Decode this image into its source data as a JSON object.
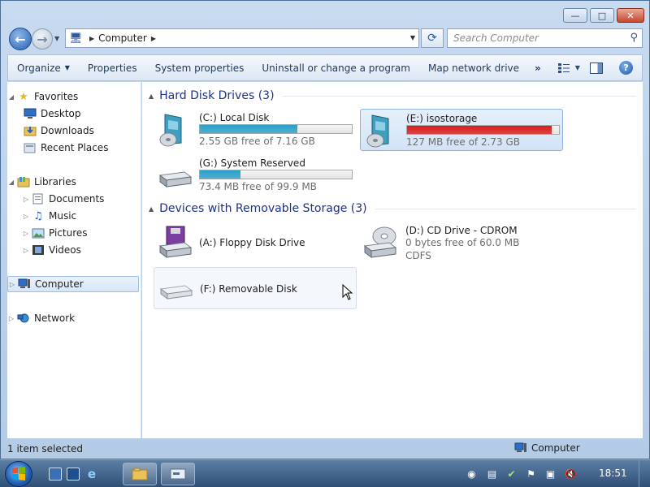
{
  "window": {
    "minimize_glyph": "—",
    "maximize_glyph": "□",
    "close_glyph": "✕"
  },
  "nav": {
    "breadcrumb": "Computer",
    "search_placeholder": "Search Computer"
  },
  "commands": {
    "organize": "Organize",
    "properties": "Properties",
    "system_properties": "System properties",
    "uninstall": "Uninstall or change a program",
    "map_drive": "Map network drive",
    "more": "»"
  },
  "navpane": {
    "favorites": "Favorites",
    "desktop": "Desktop",
    "downloads": "Downloads",
    "recent_places": "Recent Places",
    "libraries": "Libraries",
    "documents": "Documents",
    "music": "Music",
    "pictures": "Pictures",
    "videos": "Videos",
    "computer": "Computer",
    "network": "Network"
  },
  "groups": {
    "hard_disks": "Hard Disk Drives (3)",
    "removable": "Devices with Removable Storage (3)"
  },
  "drives": {
    "c": {
      "name": "(C:) Local Disk",
      "free": "2.55 GB free of 7.16 GB",
      "used_fraction": 0.64,
      "bar_color": "#2a9fc9"
    },
    "e": {
      "name": "(E:) isostorage",
      "free": "127 MB free of 2.73 GB",
      "used_fraction": 0.95,
      "bar_color": "#d81b1b"
    },
    "g": {
      "name": "(G:) System Reserved",
      "free": "73.4 MB free of 99.9 MB",
      "used_fraction": 0.27,
      "bar_color": "#2a9fc9"
    },
    "a": {
      "name": "(A:) Floppy Disk Drive"
    },
    "d": {
      "name": "(D:) CD Drive - CDROM",
      "free": "0 bytes free of 60.0 MB",
      "fs": "CDFS"
    },
    "f": {
      "name": "(F:) Removable Disk"
    }
  },
  "status": {
    "left": "1 item selected",
    "right": "Computer"
  },
  "taskbar": {
    "clock": "18:51"
  }
}
